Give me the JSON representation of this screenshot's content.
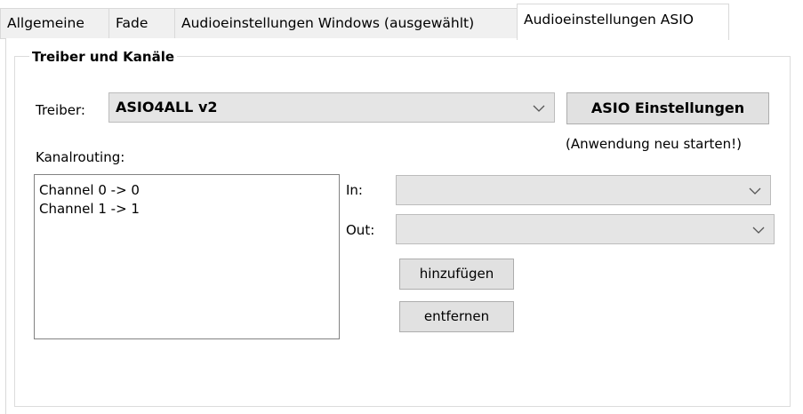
{
  "tabs": [
    {
      "label": "Allgemeine",
      "active": false
    },
    {
      "label": "Fade",
      "active": false
    },
    {
      "label": "Audioeinstellungen Windows (ausgewählt)",
      "active": false
    },
    {
      "label": "Audioeinstellungen ASIO",
      "active": true
    }
  ],
  "group": {
    "title": "Treiber und Kanäle"
  },
  "driver": {
    "label": "Treiber:",
    "selected": "ASIO4ALL v2",
    "settings_button": "ASIO Einstellungen",
    "restart_hint": "(Anwendung neu starten!)"
  },
  "routing": {
    "label": "Kanalrouting:",
    "items": [
      "Channel 0 -> 0",
      "Channel 1 -> 1"
    ],
    "in_label": "In:",
    "in_value": "",
    "out_label": "Out:",
    "out_value": "",
    "add_button": "hinzufügen",
    "remove_button": "entfernen"
  },
  "icons": {
    "dropdown": "chevron-down-icon"
  }
}
